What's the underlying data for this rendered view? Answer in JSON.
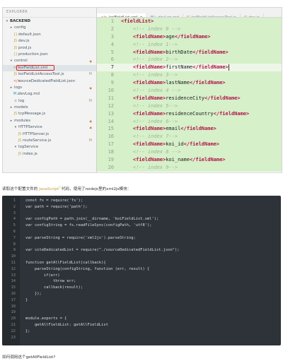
{
  "explorer": {
    "header": "EXPLORER",
    "rows": [
      {
        "icon": "▾",
        "label": "BACKEND",
        "indent": 0,
        "marker": "",
        "folder": true
      },
      {
        "icon": "▸",
        "label": "config",
        "indent": 1,
        "marker": "",
        "folder": true
      },
      {
        "icon": "{}",
        "label": "default.json",
        "indent": 2,
        "marker": ""
      },
      {
        "icon": "JS",
        "label": "dev.js",
        "indent": 2,
        "marker": ""
      },
      {
        "icon": "JS",
        "label": "prod.js",
        "indent": 2,
        "marker": ""
      },
      {
        "icon": "{}",
        "label": "production.json",
        "indent": 2,
        "marker": ""
      },
      {
        "icon": "▾",
        "label": "control",
        "indent": 1,
        "marker": "●",
        "folder": true
      },
      {
        "icon": "</>",
        "label": "koiFieldList.xml",
        "indent": 2,
        "marker": "",
        "selected": true
      },
      {
        "icon": "JS",
        "label": "koiFieldListAccessTool.js",
        "indent": 2,
        "marker": "M"
      },
      {
        "icon": "</>",
        "label": "sourceDedicatedFieldList.json",
        "indent": 2,
        "marker": ""
      },
      {
        "icon": "▸",
        "label": "logs",
        "indent": 1,
        "marker": "●",
        "folder": true
      },
      {
        "icon": "M↓",
        "label": "devLog.md",
        "indent": 2,
        "marker": ""
      },
      {
        "icon": "≡",
        "label": "log",
        "indent": 2,
        "marker": "M"
      },
      {
        "icon": "▸",
        "label": "models",
        "indent": 1,
        "marker": "",
        "folder": true
      },
      {
        "icon": "JS",
        "label": "tcpMessage.js",
        "indent": 2,
        "marker": ""
      },
      {
        "icon": "▸",
        "label": "modules",
        "indent": 1,
        "marker": "●",
        "folder": true
      },
      {
        "icon": "▾",
        "label": "HTTPService",
        "indent": 2,
        "marker": "●",
        "folder": true
      },
      {
        "icon": "JS",
        "label": "HTTPServer.js",
        "indent": 3,
        "marker": ""
      },
      {
        "icon": "JS",
        "label": "routeService.js",
        "indent": 3,
        "marker": "M"
      },
      {
        "icon": "▾",
        "label": "logService",
        "indent": 2,
        "marker": "",
        "folder": true
      },
      {
        "icon": "JS",
        "label": "index.js",
        "indent": 3,
        "marker": ""
      }
    ]
  },
  "tabs": [
    {
      "icon": "</>",
      "label": "koiFieldList.xml",
      "active": true,
      "close": "✕",
      "color": "#d2541b"
    },
    {
      "icon": "M↓",
      "label": "devLog.md",
      "active": false,
      "color": "#3b8cc4"
    },
    {
      "icon": "JS",
      "label": "koiFieldListAccessTool.js",
      "active": false,
      "color": "#c9a227"
    },
    {
      "icon": "JS",
      "label": "dev.js",
      "active": false,
      "color": "#c9a227"
    }
  ],
  "editor": {
    "current_line": 7,
    "lines": [
      {
        "n": "1",
        "kind": "open",
        "tag": "fieldList"
      },
      {
        "n": "2",
        "kind": "comment",
        "text": "<!-- index 0 -->"
      },
      {
        "n": "3",
        "kind": "field",
        "value": "age"
      },
      {
        "n": "4",
        "kind": "comment",
        "text": "<!-- index 1-->"
      },
      {
        "n": "5",
        "kind": "field",
        "value": "birthDate"
      },
      {
        "n": "6",
        "kind": "comment",
        "text": "<!-- index 2-->"
      },
      {
        "n": "7",
        "kind": "field",
        "value": "firstName"
      },
      {
        "n": "8",
        "kind": "comment",
        "text": "<!-- index 3-->"
      },
      {
        "n": "9",
        "kind": "field",
        "value": "lastName"
      },
      {
        "n": "10",
        "kind": "comment",
        "text": "<!-- index 4 -->"
      },
      {
        "n": "11",
        "kind": "field",
        "value": "residenceCity"
      },
      {
        "n": "12",
        "kind": "comment",
        "text": "<!-- index 5-->"
      },
      {
        "n": "13",
        "kind": "field",
        "value": "residenceCountry"
      },
      {
        "n": "14",
        "kind": "comment",
        "text": "<!-- index 6-->"
      },
      {
        "n": "15",
        "kind": "field",
        "value": "email"
      },
      {
        "n": "16",
        "kind": "comment",
        "text": "<!-- index 7-->"
      },
      {
        "n": "17",
        "kind": "field",
        "value": "koi_id"
      },
      {
        "n": "18",
        "kind": "comment",
        "text": "<!-- index 8 -->"
      },
      {
        "n": "19",
        "kind": "field",
        "value": "koi_name"
      },
      {
        "n": "20",
        "kind": "comment",
        "text": "<!-- index 9-->"
      }
    ]
  },
  "paragraph1": {
    "before": "读取这个配置文件的 ",
    "link": "JavaScript",
    "after": "代码，使用了nodejs里的xml2js模块："
  },
  "code_block": [
    {
      "n": "1",
      "text": "const fs = require('fs');"
    },
    {
      "n": "2",
      "text": "var path = require('path');"
    },
    {
      "n": "3",
      "text": ""
    },
    {
      "n": "4",
      "text": "var configPath = path.join(__dirname, 'koiFieldList.xml');"
    },
    {
      "n": "5",
      "text": "var configString = fs.readFileSync(configPath, 'utf8');"
    },
    {
      "n": "6",
      "text": ""
    },
    {
      "n": "7",
      "text": "var parseString = require('xml2js').parseString;"
    },
    {
      "n": "8",
      "text": ""
    },
    {
      "n": "9",
      "text": "var siteDedicatedList = require(\"./sourceDedicatedFieldList.json\");"
    },
    {
      "n": "10",
      "text": ""
    },
    {
      "n": "11",
      "text": "function getAllFieldList(callback){"
    },
    {
      "n": "12",
      "text": "    parseString(configString, function (err, result) {"
    },
    {
      "n": "13",
      "text": "        if(err)"
    },
    {
      "n": "14",
      "text": "            throw err;"
    },
    {
      "n": "15",
      "text": "        callback(result);"
    },
    {
      "n": "16",
      "text": "    });"
    },
    {
      "n": "17",
      "text": "}"
    },
    {
      "n": "18",
      "text": ""
    },
    {
      "n": "19",
      "text": ""
    },
    {
      "n": "20",
      "text": "module.exports = {"
    },
    {
      "n": "21",
      "text": "    getAllFieldList: getAllFieldList"
    },
    {
      "n": "22",
      "text": "};"
    },
    {
      "n": "23",
      "text": ""
    }
  ],
  "paragraph2": "如何调用这个getAllFieldList?",
  "colors": {
    "accent_red": "#d22222",
    "code_green": "#d6f0c9",
    "tag": "#b3154a",
    "dark_code_bg": "#2d3338"
  }
}
